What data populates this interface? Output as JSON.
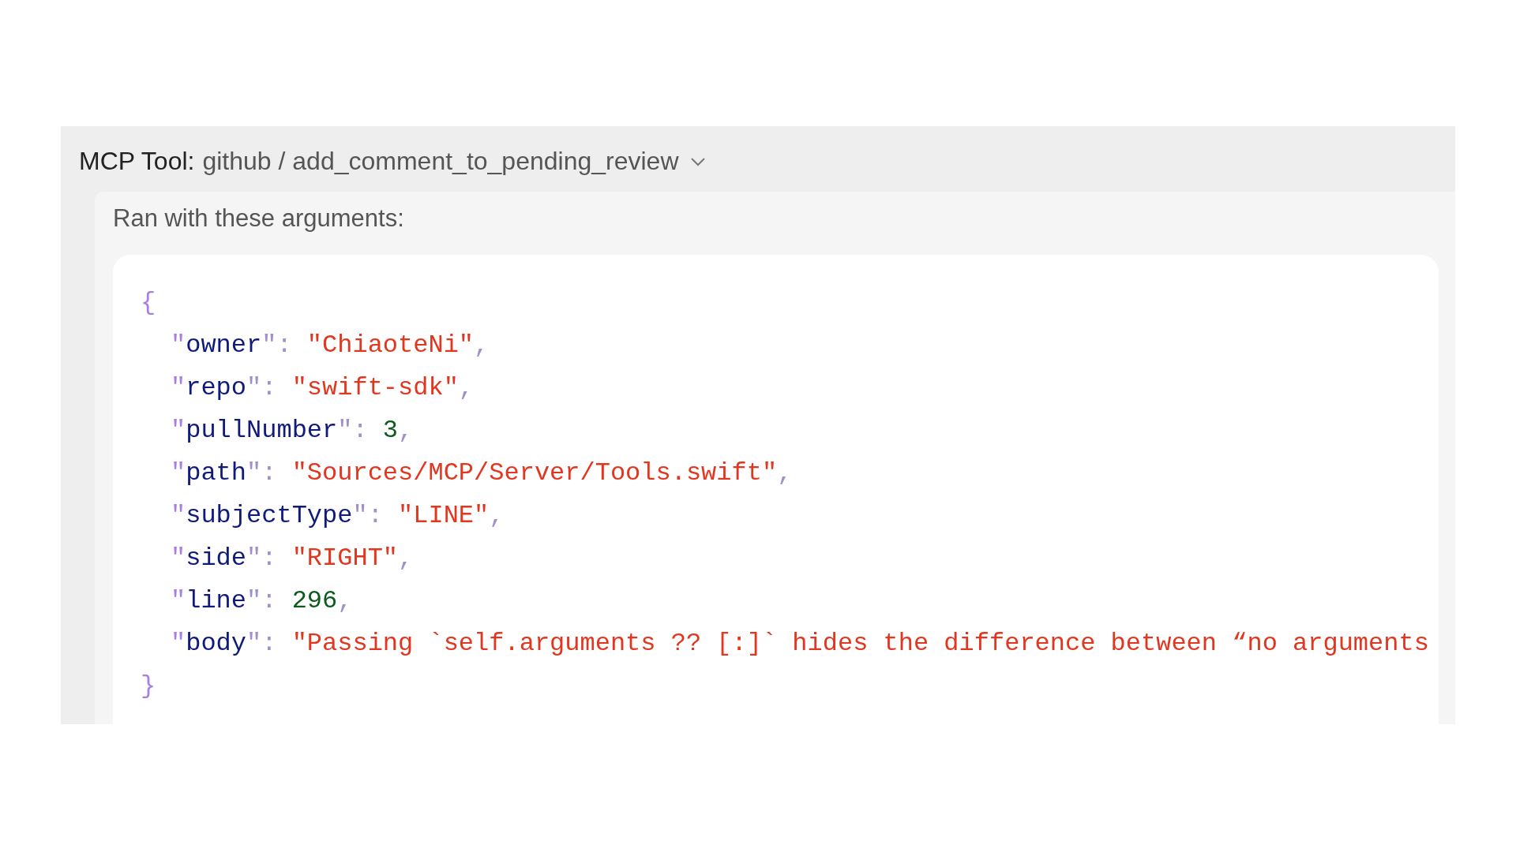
{
  "tool": {
    "label": "MCP Tool:",
    "name": "github / add_comment_to_pending_review",
    "expanded": true
  },
  "arguments_label": "Ran with these arguments:",
  "code": {
    "lines": [
      {
        "indent": false,
        "tokens": [
          {
            "text": "{",
            "kind": "brace"
          }
        ]
      },
      {
        "indent": true,
        "tokens": [
          {
            "text": "\"",
            "kind": "quote"
          },
          {
            "text": "owner",
            "kind": "key"
          },
          {
            "text": "\": ",
            "kind": "punct"
          },
          {
            "text": "\"",
            "kind": "string"
          },
          {
            "text": "ChiaoteNi",
            "kind": "string"
          },
          {
            "text": "\"",
            "kind": "string"
          },
          {
            "text": ",",
            "kind": "punct"
          }
        ]
      },
      {
        "indent": true,
        "tokens": [
          {
            "text": "\"",
            "kind": "quote"
          },
          {
            "text": "repo",
            "kind": "key"
          },
          {
            "text": "\": ",
            "kind": "punct"
          },
          {
            "text": "\"",
            "kind": "string"
          },
          {
            "text": "swift-sdk",
            "kind": "string"
          },
          {
            "text": "\"",
            "kind": "string"
          },
          {
            "text": ",",
            "kind": "punct"
          }
        ]
      },
      {
        "indent": true,
        "tokens": [
          {
            "text": "\"",
            "kind": "quote"
          },
          {
            "text": "pullNumber",
            "kind": "key"
          },
          {
            "text": "\": ",
            "kind": "punct"
          },
          {
            "text": "3",
            "kind": "number"
          },
          {
            "text": ",",
            "kind": "punct"
          }
        ]
      },
      {
        "indent": true,
        "tokens": [
          {
            "text": "\"",
            "kind": "quote"
          },
          {
            "text": "path",
            "kind": "key"
          },
          {
            "text": "\": ",
            "kind": "punct"
          },
          {
            "text": "\"",
            "kind": "string"
          },
          {
            "text": "Sources/MCP/Server/Tools.swift",
            "kind": "string"
          },
          {
            "text": "\"",
            "kind": "string"
          },
          {
            "text": ",",
            "kind": "punct"
          }
        ]
      },
      {
        "indent": true,
        "tokens": [
          {
            "text": "\"",
            "kind": "quote"
          },
          {
            "text": "subjectType",
            "kind": "key"
          },
          {
            "text": "\": ",
            "kind": "punct"
          },
          {
            "text": "\"",
            "kind": "string"
          },
          {
            "text": "LINE",
            "kind": "string"
          },
          {
            "text": "\"",
            "kind": "string"
          },
          {
            "text": ",",
            "kind": "punct"
          }
        ]
      },
      {
        "indent": true,
        "tokens": [
          {
            "text": "\"",
            "kind": "quote"
          },
          {
            "text": "side",
            "kind": "key"
          },
          {
            "text": "\": ",
            "kind": "punct"
          },
          {
            "text": "\"",
            "kind": "string"
          },
          {
            "text": "RIGHT",
            "kind": "string"
          },
          {
            "text": "\"",
            "kind": "string"
          },
          {
            "text": ",",
            "kind": "punct"
          }
        ]
      },
      {
        "indent": true,
        "tokens": [
          {
            "text": "\"",
            "kind": "quote"
          },
          {
            "text": "line",
            "kind": "key"
          },
          {
            "text": "\": ",
            "kind": "punct"
          },
          {
            "text": "296",
            "kind": "number"
          },
          {
            "text": ",",
            "kind": "punct"
          }
        ]
      },
      {
        "indent": true,
        "tokens": [
          {
            "text": "\"",
            "kind": "quote"
          },
          {
            "text": "body",
            "kind": "key"
          },
          {
            "text": "\": ",
            "kind": "punct"
          },
          {
            "text": "\"",
            "kind": "string"
          },
          {
            "text": "Passing `self.arguments ?? [:]` hides the difference between “no arguments",
            "kind": "string"
          }
        ]
      },
      {
        "indent": false,
        "tokens": [
          {
            "text": "}",
            "kind": "brace"
          }
        ]
      }
    ]
  }
}
